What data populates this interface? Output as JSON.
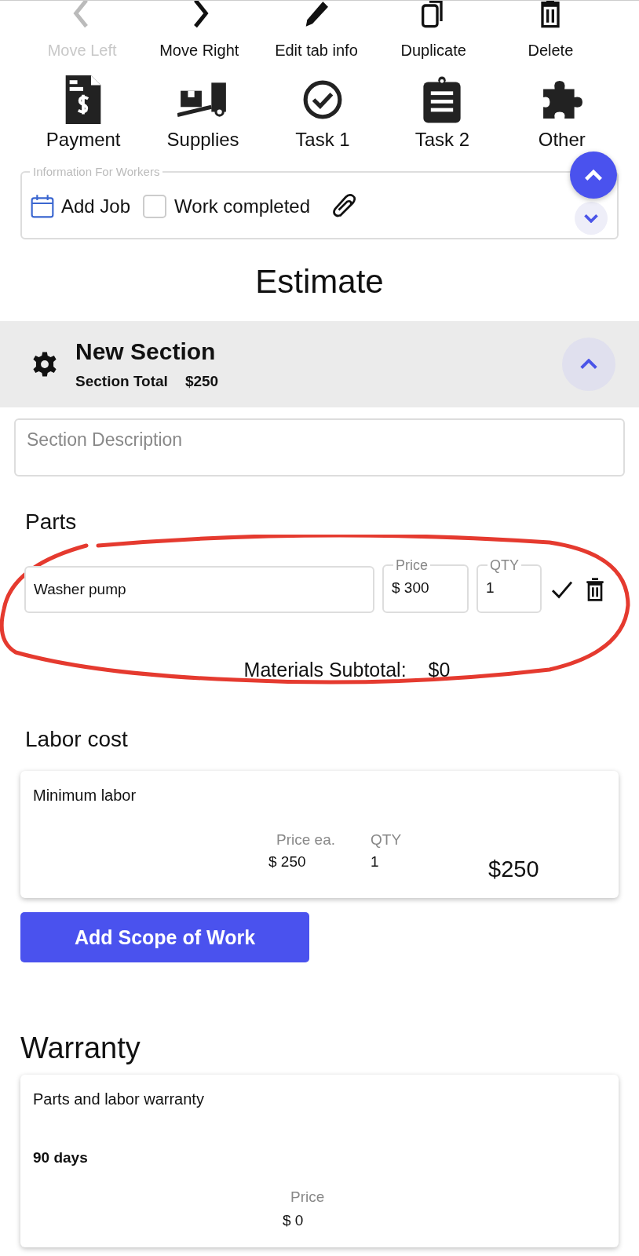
{
  "toolbar": [
    {
      "label": "Move Left",
      "disabled": true
    },
    {
      "label": "Move Right",
      "disabled": false
    },
    {
      "label": "Edit tab info",
      "disabled": false
    },
    {
      "label": "Duplicate",
      "disabled": false
    },
    {
      "label": "Delete",
      "disabled": false
    }
  ],
  "tabs": [
    {
      "label": "Payment"
    },
    {
      "label": "Supplies"
    },
    {
      "label": "Task 1"
    },
    {
      "label": "Task 2"
    },
    {
      "label": "Other"
    }
  ],
  "info": {
    "legend": "Information For Workers",
    "add_job": "Add Job",
    "work_completed": {
      "label": "Work completed",
      "checked": false
    }
  },
  "title": "Estimate",
  "section": {
    "name": "New Section",
    "total_label": "Section Total",
    "total": "$250",
    "expanded": true,
    "description_placeholder": "Section Description",
    "parts_heading": "Parts",
    "part": {
      "name": "Washer pump",
      "price_label": "Price",
      "price": "$ 300",
      "qty_label": "QTY",
      "qty": "1"
    },
    "materials_label": "Materials Subtotal:",
    "materials_total": "$0",
    "labor_heading": "Labor cost",
    "labor": {
      "name": "Minimum labor",
      "price_label": "Price ea.",
      "price": "$ 250",
      "qty_label": "QTY",
      "qty": "1",
      "total": "$250"
    },
    "add_button": "Add Scope of Work"
  },
  "warranty": {
    "heading": "Warranty",
    "name": "Parts and labor warranty",
    "term": "90 days",
    "price_label": "Price",
    "price": "$ 0"
  }
}
